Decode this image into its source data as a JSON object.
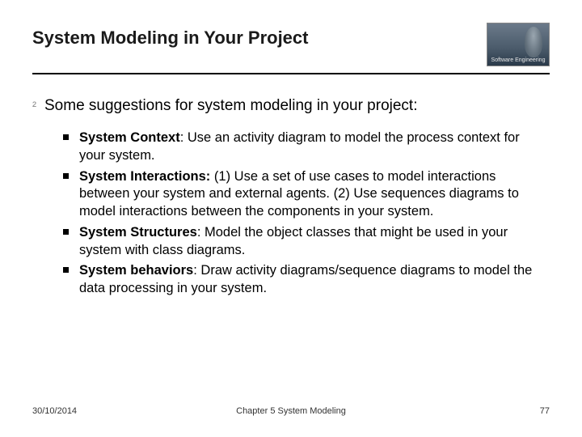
{
  "header": {
    "title": "System Modeling in Your Project",
    "logo_label": "Software Engineering"
  },
  "lead": {
    "text": "Some suggestions for system modeling in your project:"
  },
  "bullets": [
    {
      "term": "System Context",
      "text": ": Use an activity diagram to model the process context for your system."
    },
    {
      "term": "System Interactions:",
      "text": " (1) Use a set of use cases to model interactions between your system and external agents. (2) Use sequences diagrams to model interactions between the components in your system."
    },
    {
      "term": "System Structures",
      "text": ": Model the object classes that might be used in your system with class diagrams."
    },
    {
      "term": "System behaviors",
      "text": ": Draw activity diagrams/sequence diagrams to model the data processing in your system."
    }
  ],
  "footer": {
    "date": "30/10/2014",
    "chapter": "Chapter 5 System Modeling",
    "page": "77"
  }
}
